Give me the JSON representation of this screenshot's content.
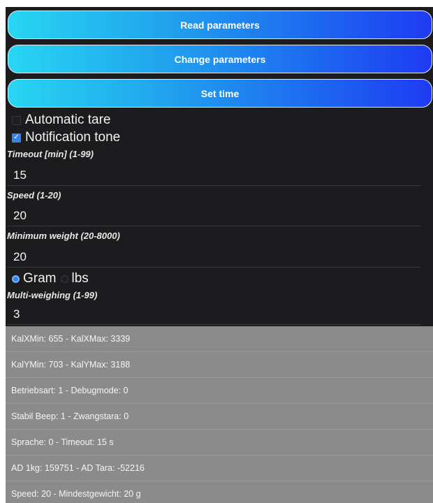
{
  "buttons": {
    "read": "Read parameters",
    "change": "Change parameters",
    "settime": "Set time"
  },
  "options": {
    "automatic_tare": {
      "label": "Automatic tare",
      "checked": false
    },
    "notification_tone": {
      "label": "Notification tone",
      "checked": true
    }
  },
  "fields": {
    "timeout": {
      "label": "Timeout [min] (1-99)",
      "value": "15"
    },
    "speed": {
      "label": "Speed (1-20)",
      "value": "20"
    },
    "min_weight": {
      "label": "Minimum weight (20-8000)",
      "value": "20"
    },
    "multi_weighing": {
      "label": "Multi-weighing (1-99)",
      "value": "3"
    }
  },
  "units": {
    "gram": {
      "label": "Gram",
      "selected": true
    },
    "lbs": {
      "label": "lbs",
      "selected": false
    }
  },
  "info": [
    "KalXMin: 655 - KalXMax: 3339",
    "KalYMin: 703 - KalYMax: 3188",
    "Betriebsart: 1 - Debugmode: 0",
    "Stabil Beep: 1 - Zwangstara: 0",
    "Sprache: 0 - Timeout: 15 s",
    "AD 1kg: 159751 - AD Tara: -52216",
    "Speed: 20 - Mindestgewicht: 20 g"
  ],
  "colors": {
    "accent": "#3b82e8",
    "background": "#1c1c1f",
    "info_panel": "#8b8b8b"
  }
}
